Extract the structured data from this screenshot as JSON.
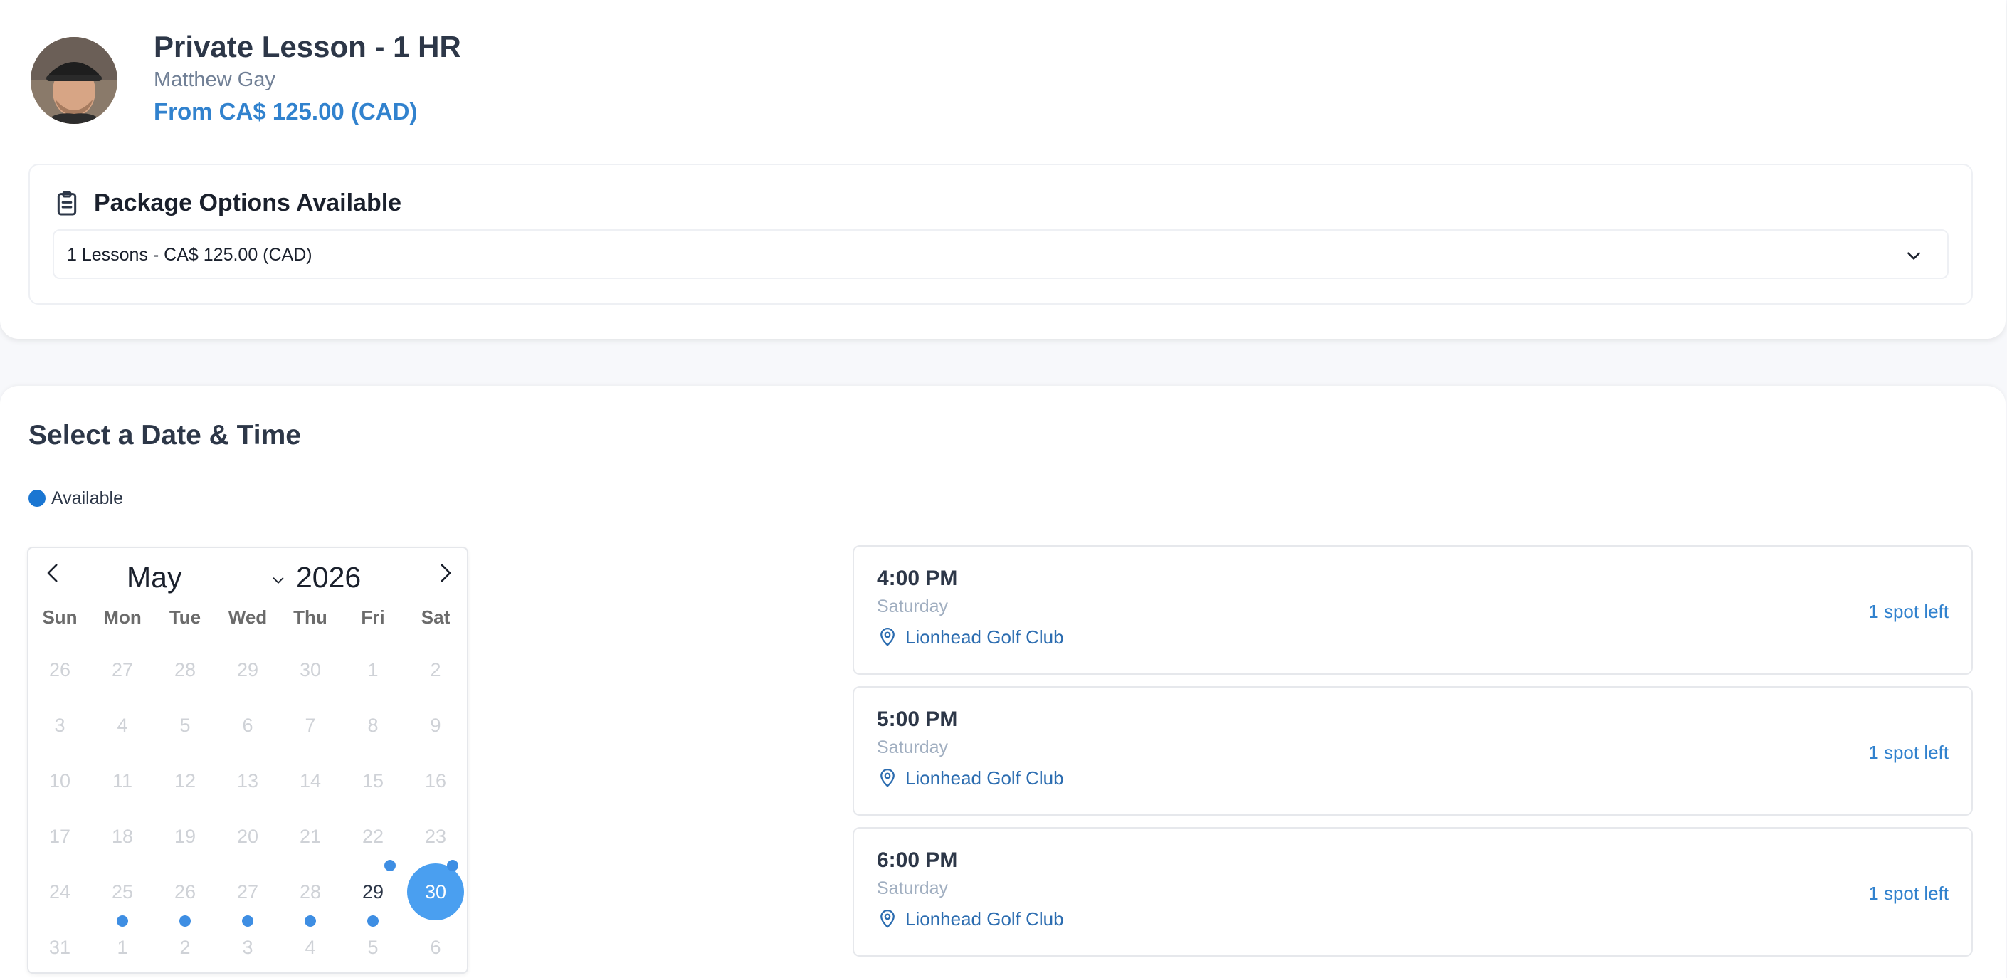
{
  "lesson": {
    "title": "Private Lesson - 1 HR",
    "instructor": "Matthew Gay",
    "price": "From CA$ 125.00 (CAD)"
  },
  "package": {
    "heading": "Package Options Available",
    "selected": "1 Lessons - CA$ 125.00 (CAD)",
    "icon": "clipboard-icon"
  },
  "schedule": {
    "heading": "Select a Date & Time",
    "legend_label": "Available"
  },
  "calendar": {
    "month": "May",
    "year": "2026",
    "weekdays": [
      "Sun",
      "Mon",
      "Tue",
      "Wed",
      "Thu",
      "Fri",
      "Sat"
    ],
    "weeks": [
      [
        "26",
        "27",
        "28",
        "29",
        "30",
        "1",
        "2"
      ],
      [
        "3",
        "4",
        "5",
        "6",
        "7",
        "8",
        "9"
      ],
      [
        "10",
        "11",
        "12",
        "13",
        "14",
        "15",
        "16"
      ],
      [
        "17",
        "18",
        "19",
        "20",
        "21",
        "22",
        "23"
      ],
      [
        "24",
        "25",
        "26",
        "27",
        "28",
        "29",
        "30"
      ],
      [
        "31",
        "1",
        "2",
        "3",
        "4",
        "5",
        "6"
      ]
    ],
    "selected": "30"
  },
  "slots": [
    {
      "time": "4:00 PM",
      "day": "Saturday",
      "location": "Lionhead Golf Club",
      "spots": "1 spot left"
    },
    {
      "time": "5:00 PM",
      "day": "Saturday",
      "location": "Lionhead Golf Club",
      "spots": "1 spot left"
    },
    {
      "time": "6:00 PM",
      "day": "Saturday",
      "location": "Lionhead Golf Club",
      "spots": "1 spot left"
    }
  ],
  "colors": {
    "accent": "#3182ce",
    "available_dot": "#1a76d2",
    "selected_day": "#4a9ff0"
  }
}
